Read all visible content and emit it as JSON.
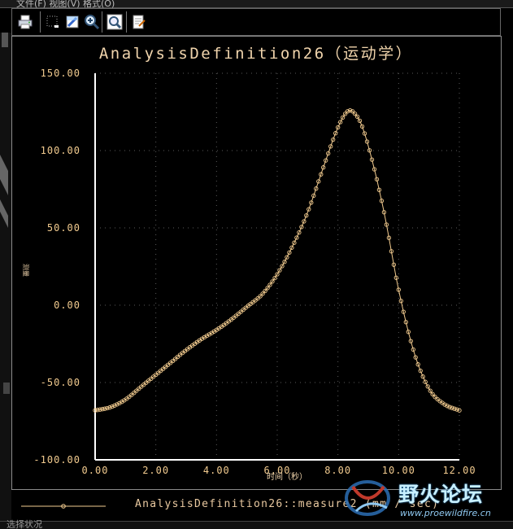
{
  "menu": {
    "fragment": "文件(F)  视图(V)  格式(O)"
  },
  "toolbar": {
    "buttons": [
      {
        "icon": "printer-icon"
      },
      {
        "icon": "dotted-box-icon"
      },
      {
        "icon": "format-icon"
      },
      {
        "icon": "zoom-in-icon"
      },
      {
        "icon": "zoom-fit-icon"
      },
      {
        "icon": "edit-icon"
      }
    ]
  },
  "chart_data": {
    "type": "line",
    "title": "AnalysisDefinition26（运动学）",
    "xlabel": "时间（秒）",
    "ylabel": "测量",
    "xlim": [
      0,
      12
    ],
    "ylim": [
      -100,
      150
    ],
    "x_ticks": [
      "0.00",
      "2.00",
      "4.00",
      "6.00",
      "8.00",
      "10.00",
      "12.00"
    ],
    "y_ticks": [
      "150.00",
      "100.00",
      "50.00",
      "0.00",
      "-50.00",
      "-100.00"
    ],
    "grid": true,
    "marker": "circle",
    "line_color": "#f2cb8f",
    "background": "#000000",
    "series": [
      {
        "name": "AnalysisDefinition26::measure2 (mm / sec)",
        "x": [
          0,
          0.5,
          1,
          1.5,
          2,
          2.5,
          3,
          3.5,
          4,
          4.5,
          5,
          5.5,
          6,
          6.5,
          7,
          7.5,
          8,
          8.25,
          8.4,
          8.5,
          8.75,
          9,
          9.5,
          10,
          10.5,
          11,
          11.5,
          12
        ],
        "y": [
          -68,
          -66,
          -61,
          -53,
          -45,
          -37,
          -29,
          -22,
          -16,
          -9,
          -1,
          7,
          20,
          38,
          60,
          88,
          115,
          124,
          126,
          125,
          118,
          103,
          62,
          10,
          -30,
          -54,
          -64,
          -68
        ]
      }
    ]
  },
  "watermark": {
    "title": "野火论坛",
    "url": "www.proewildfire.cn"
  },
  "bottom_label": "选择状况"
}
